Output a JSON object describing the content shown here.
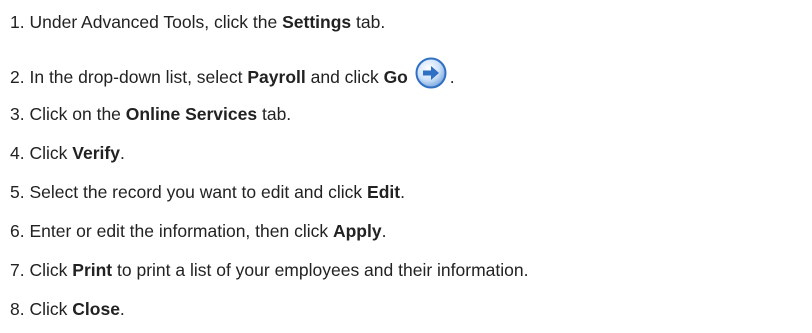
{
  "steps": [
    {
      "num": "1.",
      "parts": [
        "Under Advanced Tools, click the ",
        "Settings",
        " tab."
      ]
    },
    {
      "num": "2.",
      "parts": [
        "In the drop-down list, select ",
        "Payroll",
        " and click ",
        "Go",
        "."
      ],
      "icon": "go-arrow-icon"
    },
    {
      "num": "3.",
      "parts": [
        "Click on the ",
        "Online Services",
        " tab."
      ]
    },
    {
      "num": "4.",
      "parts": [
        "Click ",
        "Verify",
        "."
      ]
    },
    {
      "num": "5.",
      "parts": [
        "Select the record you want to edit and click ",
        "Edit",
        "."
      ]
    },
    {
      "num": "6.",
      "parts": [
        "Enter or edit the information, then click ",
        "Apply",
        "."
      ]
    },
    {
      "num": "7.",
      "parts": [
        "Click ",
        "Print",
        " to print a list of your employees and their information."
      ]
    },
    {
      "num": "8.",
      "parts": [
        "Click ",
        "Close",
        "."
      ]
    }
  ],
  "colors": {
    "text": "#222222",
    "icon_blue": "#2f6fc4",
    "icon_light": "#cfe3fb"
  }
}
